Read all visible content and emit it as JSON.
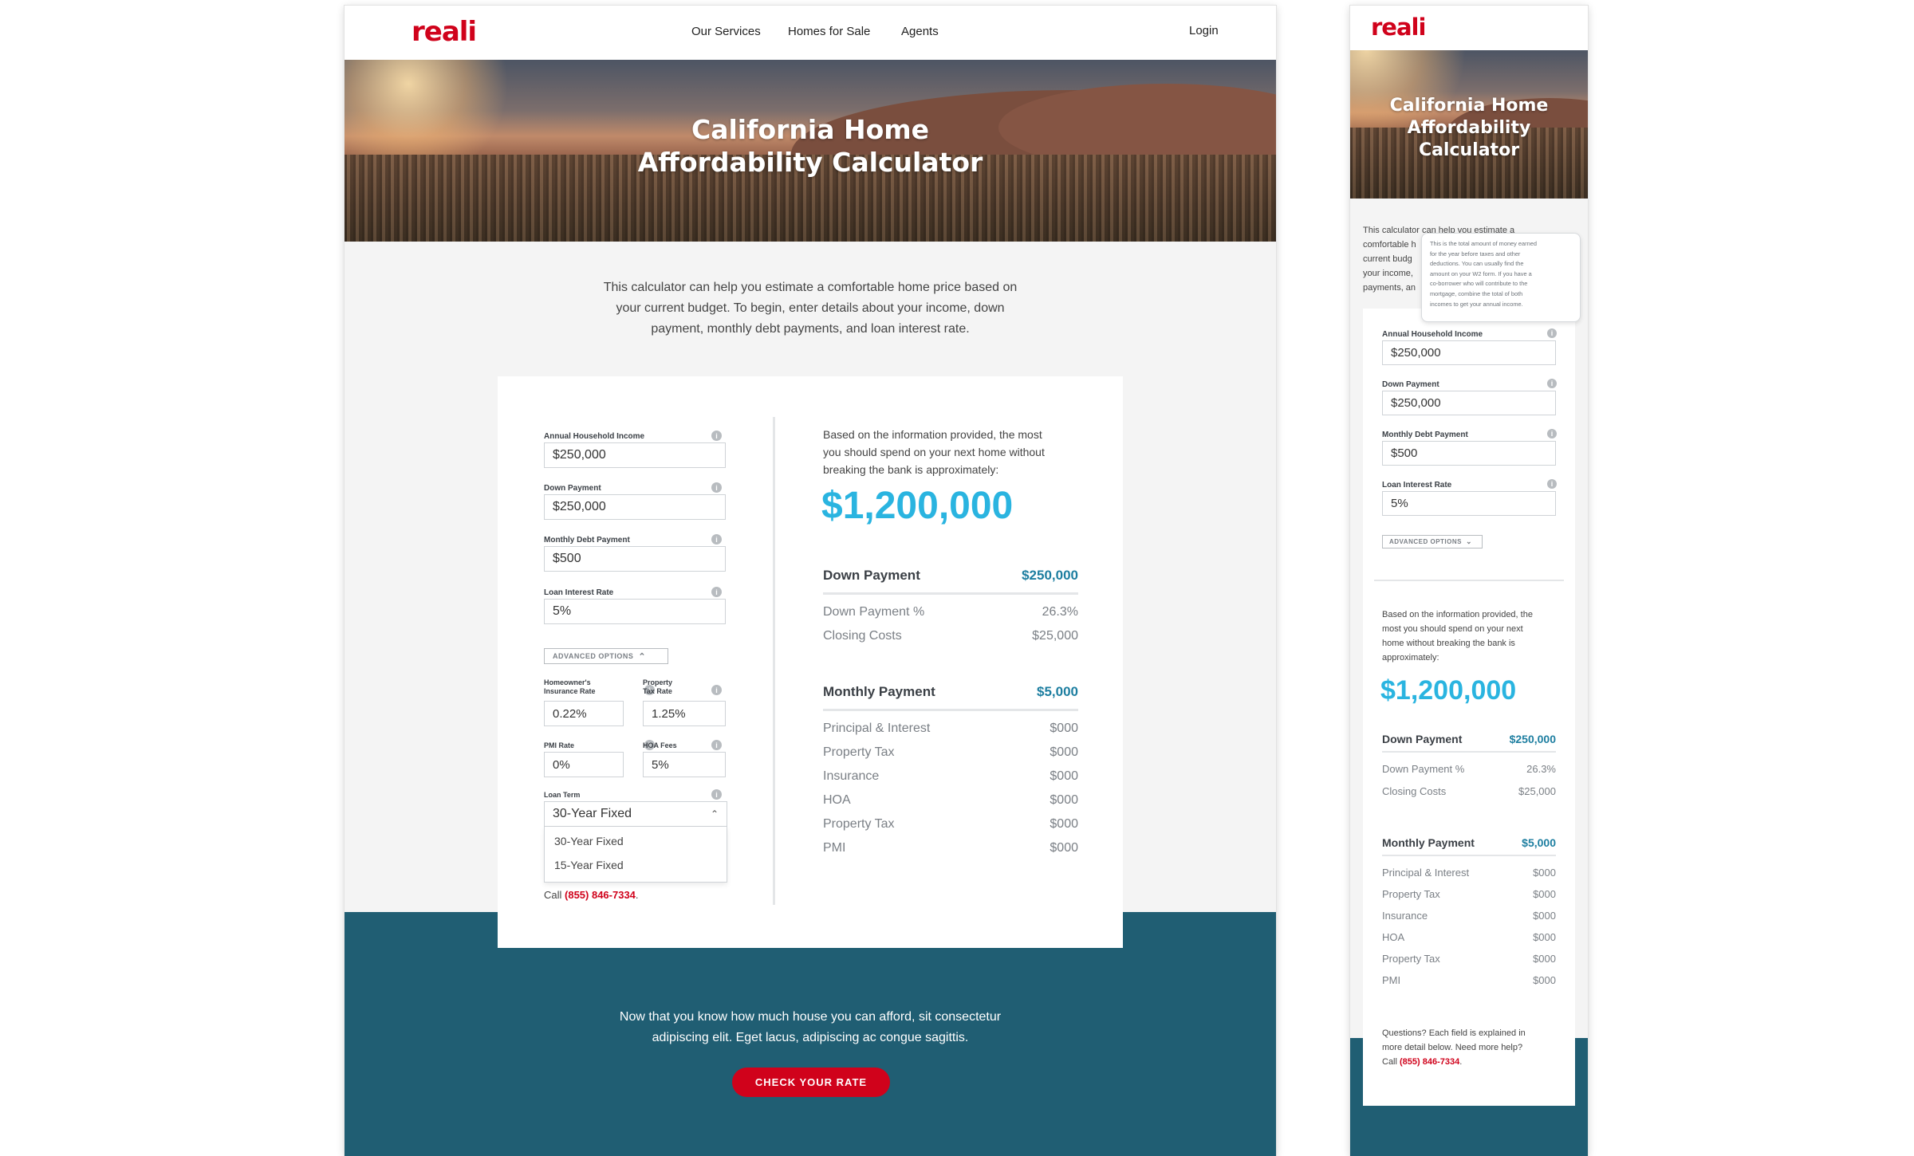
{
  "colors": {
    "brand_red": "#d0021b",
    "teal": "#205e73",
    "accent_blue": "#2ab4e0",
    "amount_teal": "#1d7ea0"
  },
  "brand": {
    "logo": "reali"
  },
  "nav": {
    "services": "Our Services",
    "homes": "Homes for Sale",
    "agents": "Agents",
    "login": "Login"
  },
  "hero": {
    "line1": "California Home",
    "line2": "Affordability Calculator",
    "mob_line1": "California Home",
    "mob_line2": "Affordability",
    "mob_line3": "Calculator"
  },
  "intro": {
    "l1": "This calculator can help you estimate a comfortable home price based on",
    "l2": "your current budget. To begin, enter details about your income, down",
    "l3": "payment, monthly debt payments, and loan interest rate."
  },
  "mobile_intro": {
    "l1": "This calculator can help you estimate a",
    "l2": "comfortable h",
    "l3": "current budg",
    "l4": "your income,",
    "l5": "payments, an"
  },
  "tooltip": {
    "l1": "This is the total amount of money earned",
    "l2": "for the year before taxes and other",
    "l3": "deductions. You can usually find the",
    "l4": "amount on your W2 form. If you have a",
    "l5": "co-borrower who will contribute to the",
    "l6": "mortgage, combine the total of both",
    "l7": "incomes to get your annual income."
  },
  "form": {
    "income": {
      "label": "Annual Household Income",
      "value": "$250,000"
    },
    "down": {
      "label": "Down Payment",
      "value": "$250,000"
    },
    "debt": {
      "label": "Monthly Debt Payment",
      "value": "$500"
    },
    "rate": {
      "label": "Loan Interest Rate",
      "value": "5%"
    },
    "advanced": "ADVANCED OPTIONS",
    "ins": {
      "label1": "Homeowner's",
      "label2": "Insurance Rate",
      "value": "0.22%"
    },
    "ptax": {
      "label1": "Property",
      "label2": "Tax Rate",
      "value": "1.25%"
    },
    "pmi": {
      "label": "PMI Rate",
      "value": "0%"
    },
    "hoa": {
      "label": "HOA Fees",
      "value": "5%"
    },
    "term": {
      "label": "Loan Term",
      "value": "30-Year Fixed",
      "options": [
        "30-Year Fixed",
        "15-Year Fixed"
      ]
    },
    "call_prefix": "Call ",
    "phone": "(855) 846-7334",
    "call_suffix": "."
  },
  "result": {
    "intro1": "Based on the information provided, the most",
    "intro2": "you should spend on your next home without",
    "intro3": "breaking the bank is approximately:",
    "amount": "$1,200,000",
    "down": {
      "title": "Down Payment",
      "value": "$250,000",
      "rows": [
        {
          "k": "Down Payment %",
          "v": "26.3%"
        },
        {
          "k": "Closing Costs",
          "v": "$25,000"
        }
      ]
    },
    "monthly": {
      "title": "Monthly Payment",
      "value": "$5,000",
      "rows": [
        {
          "k": "Principal & Interest",
          "v": "$000"
        },
        {
          "k": "Property Tax",
          "v": "$000"
        },
        {
          "k": "Insurance",
          "v": "$000"
        },
        {
          "k": "HOA",
          "v": "$000"
        },
        {
          "k": "Property Tax",
          "v": "$000"
        },
        {
          "k": "PMI",
          "v": "$000"
        }
      ]
    }
  },
  "mobile_result": {
    "intro1": "Based on the information provided, the",
    "intro2": "most you should spend on your next",
    "intro3": "home without breaking the bank is",
    "intro4": "approximately:"
  },
  "questions": {
    "l1": "Questions? Each field is explained in",
    "l2": "more detail below. Need more help?",
    "l3": "Call "
  },
  "footer": {
    "l1": "Now that you know how much house you can afford, sit consectetur",
    "l2": "adipiscing elit. Eget lacus, adipiscing ac congue sagittis.",
    "cta": "CHECK YOUR RATE"
  }
}
